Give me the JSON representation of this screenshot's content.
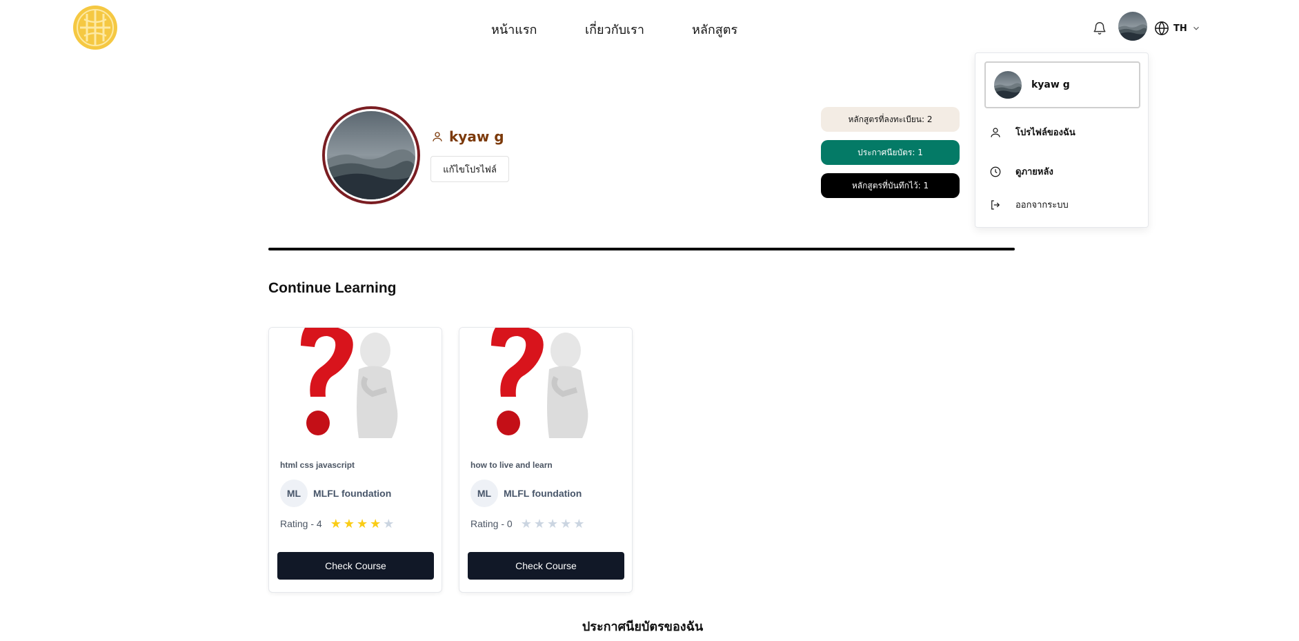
{
  "header": {
    "nav": [
      {
        "label": "หน้าแรก"
      },
      {
        "label": "เกี่ยวกับเรา"
      },
      {
        "label": "หลักสูตร"
      }
    ],
    "language": "TH",
    "logo_color": "#f5c842"
  },
  "dropdown": {
    "user_name": "kyaw g",
    "items": [
      {
        "label": "โปรไฟล์ของฉัน",
        "icon": "user-icon"
      },
      {
        "label": "ดูภายหลัง",
        "icon": "clock-icon"
      },
      {
        "label": "ออกจากระบบ",
        "icon": "logout-icon"
      }
    ]
  },
  "profile": {
    "name": "kyaw g",
    "edit_label": "แก้ไขโปรไฟล์",
    "stats": {
      "enrolled": "หลักสูตรที่ลงทะเบียน: 2",
      "certificates": "ประกาศนียบัตร: 1",
      "saved": "หลักสูตรที่บันทึกไว้: 1"
    },
    "colors": {
      "border": "#7a1d22",
      "name": "#7c3a0b",
      "certificates": "#047a66"
    }
  },
  "continue_learning": {
    "title": "Continue Learning",
    "courses": [
      {
        "title": "html css javascript",
        "author_initials": "ML",
        "author": "MLFL foundation",
        "rating_label": "Rating - 4",
        "rating": 4,
        "button": "Check Course"
      },
      {
        "title": "how to live and learn",
        "author_initials": "ML",
        "author": "MLFL foundation",
        "rating_label": "Rating - 0",
        "rating": 0,
        "button": "Check Course"
      }
    ]
  },
  "certificates_section": {
    "title": "ประกาศนียบัตรของฉัน"
  }
}
